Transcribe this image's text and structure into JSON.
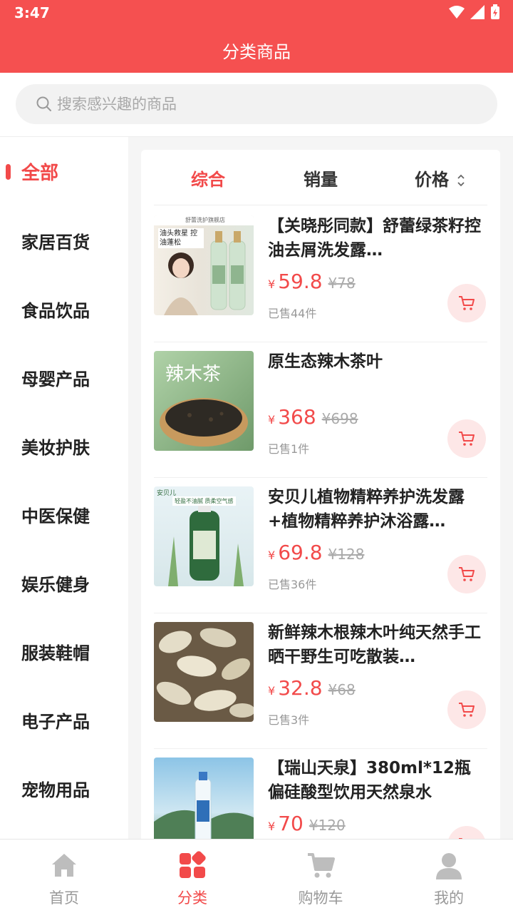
{
  "status_bar": {
    "time": "3:47"
  },
  "header": {
    "title": "分类商品"
  },
  "search": {
    "placeholder": "搜索感兴趣的商品"
  },
  "sidebar": {
    "items": [
      {
        "label": "全部"
      },
      {
        "label": "家居百货"
      },
      {
        "label": "食品饮品"
      },
      {
        "label": "母婴产品"
      },
      {
        "label": "美妆护肤"
      },
      {
        "label": "中医保健"
      },
      {
        "label": "娱乐健身"
      },
      {
        "label": "服装鞋帽"
      },
      {
        "label": "电子产品"
      },
      {
        "label": "宠物用品"
      }
    ]
  },
  "sort_tabs": {
    "overall": "综合",
    "sales": "销量",
    "price": "价格"
  },
  "products": [
    {
      "name": "【关晓彤同款】舒蕾绿茶籽控油去屑洗发露…",
      "currency": "¥",
      "price": "59.8",
      "original_price": "¥78",
      "sold": "已售44件",
      "thumb_caption": "油头救星 控油蓬松",
      "thumb_store": "舒蕾洗护旗舰店"
    },
    {
      "name": "原生态辣木茶叶",
      "currency": "¥",
      "price": "368",
      "original_price": "¥698",
      "sold": "已售1件",
      "thumb_caption": "辣木茶"
    },
    {
      "name": "安贝儿植物精粹养护洗发露+植物精粹养护沐浴露…",
      "currency": "¥",
      "price": "69.8",
      "original_price": "¥128",
      "sold": "已售36件",
      "thumb_caption": "轻盈不油腻 质柔空气感",
      "thumb_brand": "安贝儿"
    },
    {
      "name": "新鲜辣木根辣木叶纯天然手工晒干野生可吃散装…",
      "currency": "¥",
      "price": "32.8",
      "original_price": "¥68",
      "sold": "已售3件"
    },
    {
      "name": "【瑞山天泉】380ml*12瓶偏硅酸型饮用天然泉水",
      "currency": "¥",
      "price": "70",
      "original_price": "¥120",
      "sold": ""
    }
  ],
  "tab_bar": {
    "items": [
      {
        "label": "首页"
      },
      {
        "label": "分类"
      },
      {
        "label": "购物车"
      },
      {
        "label": "我的"
      }
    ]
  },
  "colors": {
    "accent": "#f55050",
    "price": "#f24a4a",
    "cart_bg": "#fde7e7"
  }
}
